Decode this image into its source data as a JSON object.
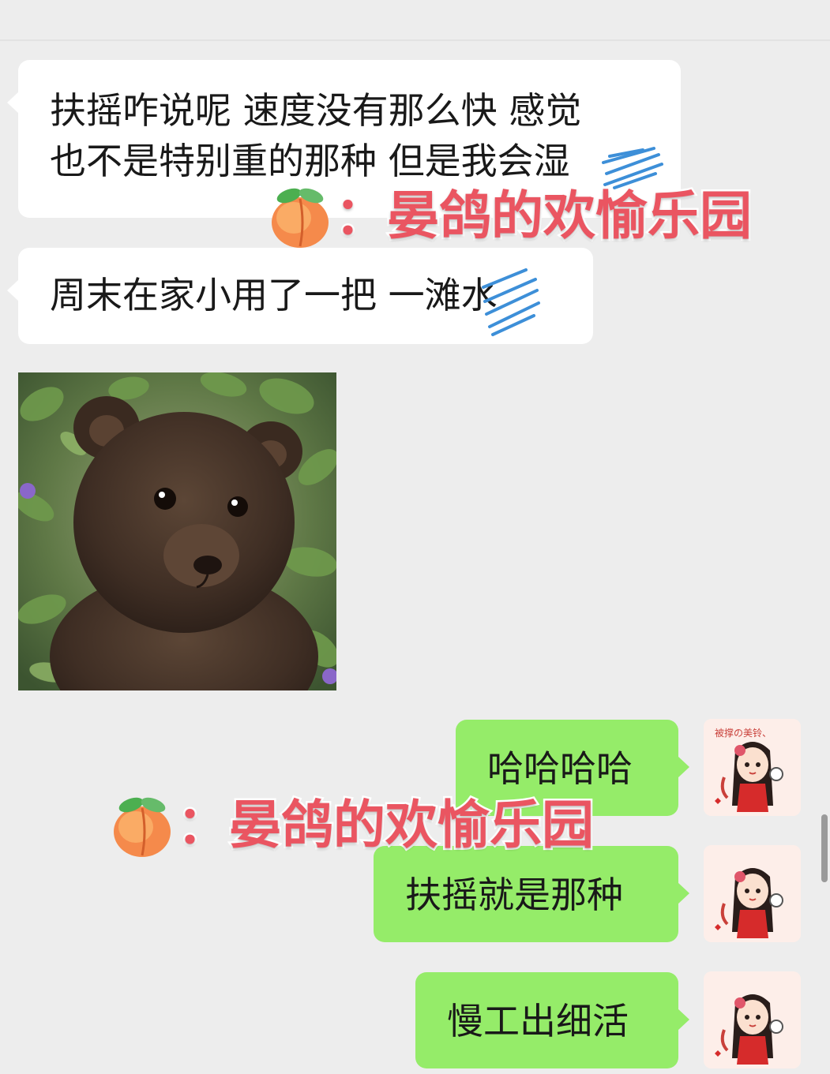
{
  "top_partial_text": "",
  "messages": {
    "incoming": [
      {
        "lines": [
          "扶摇咋说呢  速度没有那么快 感觉",
          "也不是特别重的那种  但是我会湿"
        ]
      },
      {
        "lines": [
          "周末在家小用了一把  一滩水"
        ]
      }
    ],
    "outgoing": [
      {
        "text": "哈哈哈哈"
      },
      {
        "text": "扶摇就是那种"
      },
      {
        "text": "慢工出细活"
      }
    ]
  },
  "watermark": {
    "text": "：晏鸽的欢愉乐园",
    "emoji": "peach-emoji",
    "color": "#ea5561"
  },
  "avatar": {
    "caption": "被撑の美铃、",
    "icon": "anime-girl-avatar"
  },
  "colors": {
    "background": "#ededed",
    "incoming_bubble": "#ffffff",
    "outgoing_bubble": "#95ec69",
    "scribble": "#3d8fd8"
  }
}
